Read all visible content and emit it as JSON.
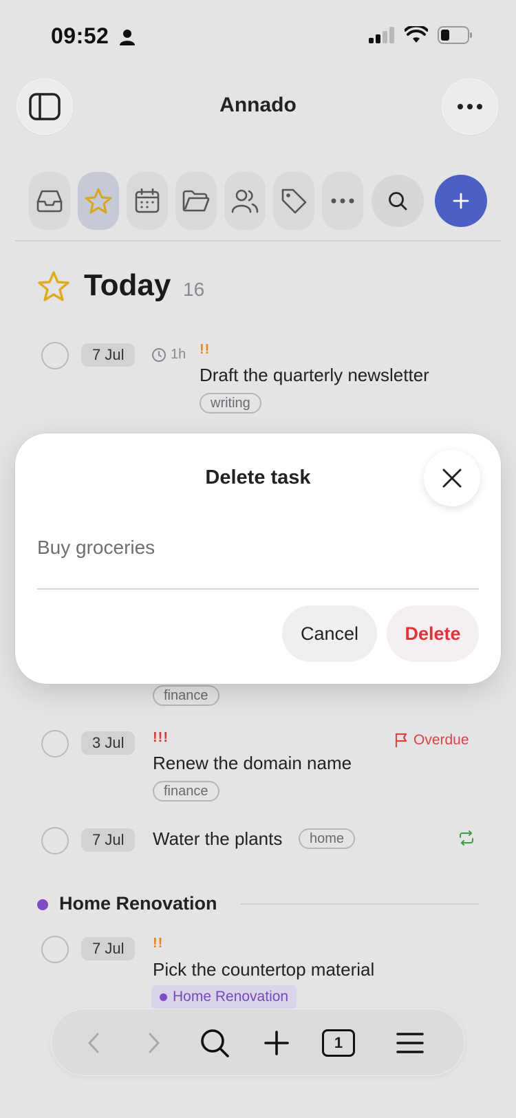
{
  "status": {
    "time": "09:52"
  },
  "app": {
    "title": "Annado"
  },
  "toolbar": {
    "items": [
      "inbox-icon",
      "star-icon",
      "calendar-icon",
      "folder-icon",
      "people-icon",
      "tag-icon",
      "more-icon"
    ],
    "active": "star-icon"
  },
  "heading": {
    "title": "Today",
    "count": "16"
  },
  "tasks": [
    {
      "date": "7 Jul",
      "duration": "1h",
      "priority": "!!",
      "title": "Draft the quarterly newsletter",
      "tag": "writing"
    },
    {
      "tag": "finance"
    },
    {
      "date": "3 Jul",
      "priority": "!!!",
      "title": "Renew the domain name",
      "tag": "finance",
      "status": "Overdue"
    },
    {
      "date": "7 Jul",
      "title": "Water the plants",
      "tag": "home",
      "repeat": true
    }
  ],
  "section": {
    "title": "Home Renovation",
    "color": "#7c4fc0",
    "tasks": [
      {
        "date": "7 Jul",
        "priority": "!!",
        "title": "Pick the countertop material",
        "project": "Home Renovation"
      }
    ]
  },
  "modal": {
    "title": "Delete task",
    "task_name": "Buy groceries",
    "cancel_label": "Cancel",
    "delete_label": "Delete"
  },
  "browser": {
    "tab_count": "1"
  },
  "colors": {
    "accent": "#4c5fc4",
    "danger": "#e0343d",
    "priority_high": "#e4861c",
    "overdue": "#d94343"
  }
}
